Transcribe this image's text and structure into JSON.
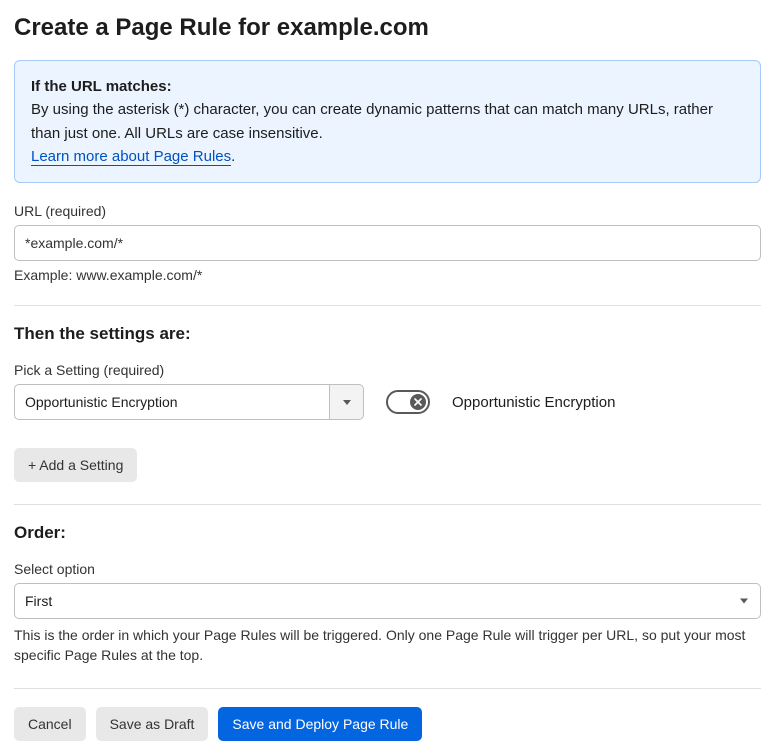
{
  "header": {
    "title": "Create a Page Rule for example.com"
  },
  "infoBox": {
    "title": "If the URL matches:",
    "body": "By using the asterisk (*) character, you can create dynamic patterns that can match many URLs, rather than just one. All URLs are case insensitive.",
    "linkText": "Learn more about Page Rules",
    "trailing": "."
  },
  "urlField": {
    "label": "URL (required)",
    "value": "*example.com/*",
    "example": "Example: www.example.com/*"
  },
  "settings": {
    "title": "Then the settings are:",
    "pickLabel": "Pick a Setting (required)",
    "selected": "Opportunistic Encryption",
    "toggleLabel": "Opportunistic Encryption",
    "addBtn": "+ Add a Setting"
  },
  "order": {
    "title": "Order:",
    "selectLabel": "Select option",
    "selected": "First",
    "help": "This is the order in which your Page Rules will be triggered. Only one Page Rule will trigger per URL, so put your most specific Page Rules at the top."
  },
  "actions": {
    "cancel": "Cancel",
    "draft": "Save as Draft",
    "deploy": "Save and Deploy Page Rule"
  }
}
